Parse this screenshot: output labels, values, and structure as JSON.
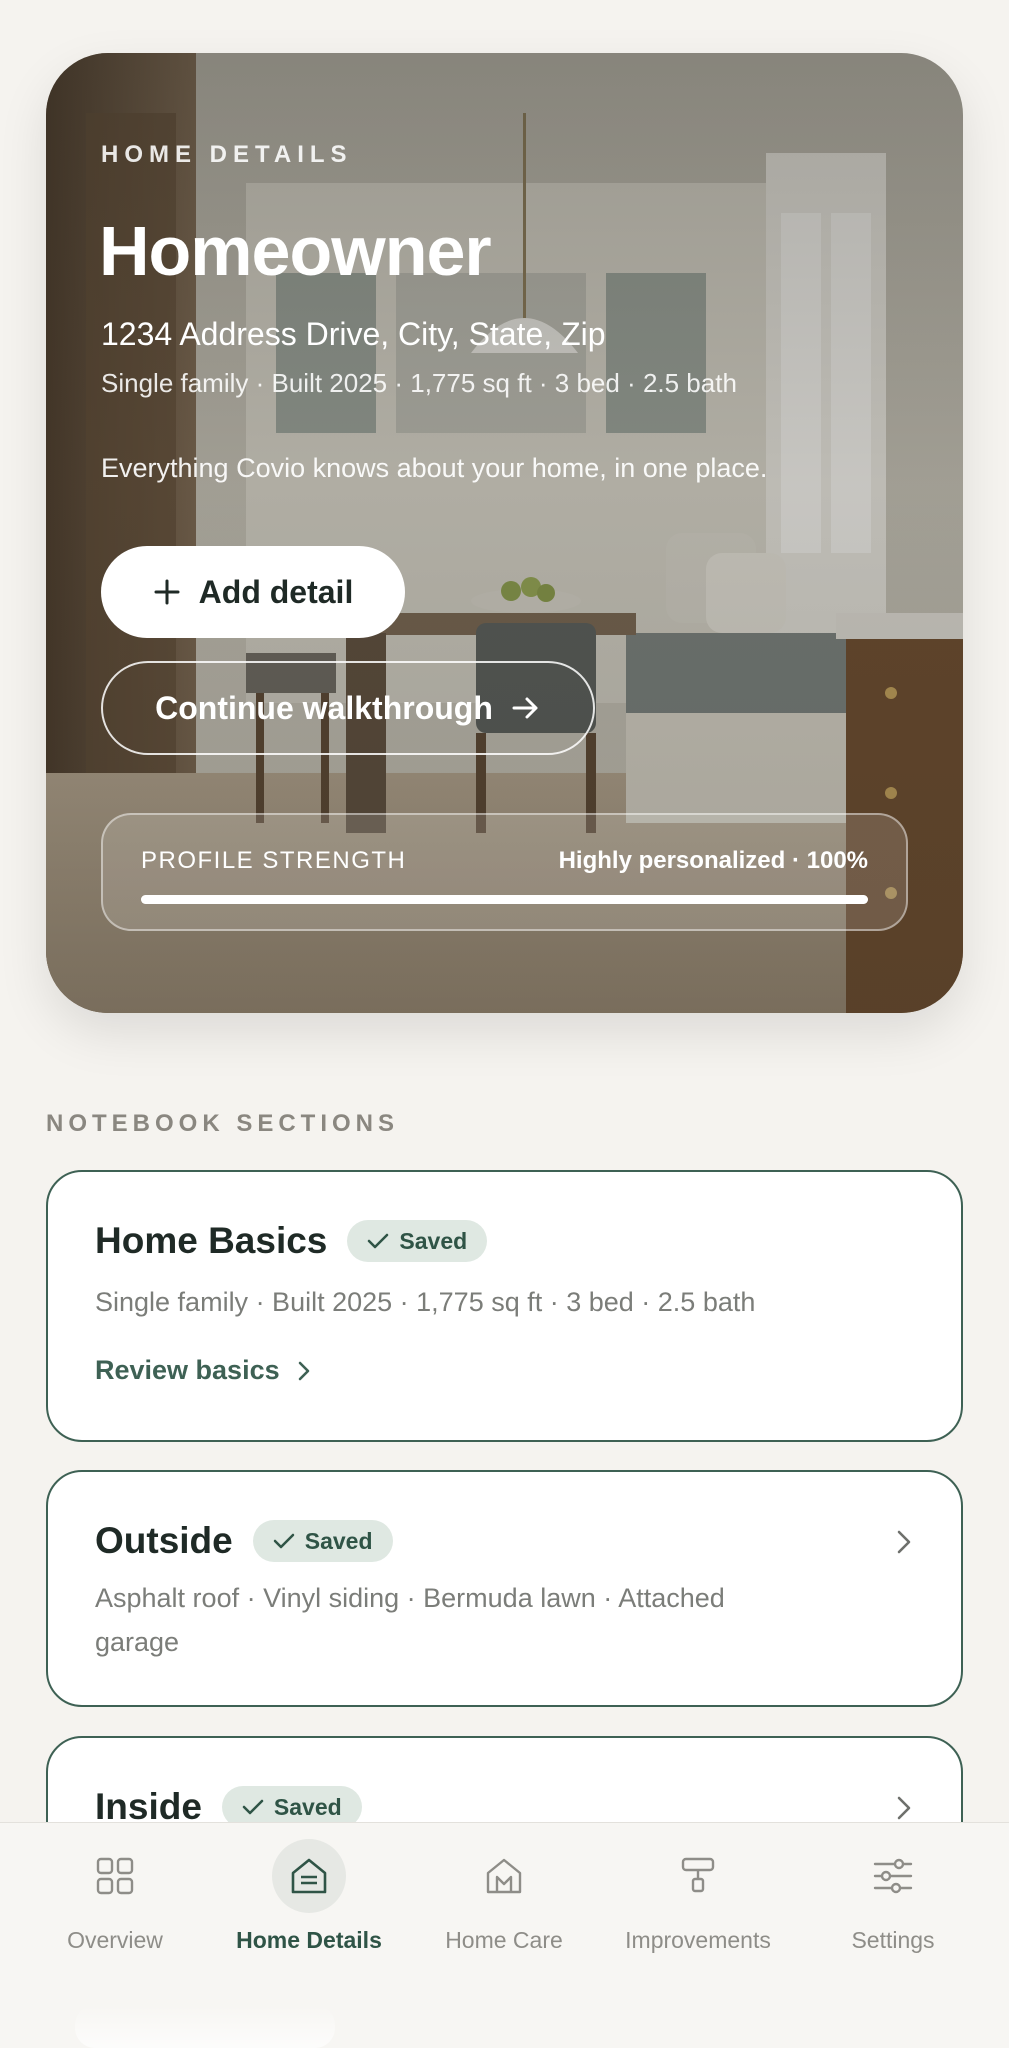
{
  "hero": {
    "eyebrow": "HOME DETAILS",
    "title": "Homeowner",
    "address": "1234 Address Drive, City, State, Zip",
    "meta": "Single family · Built 2025 · 1,775 sq ft · 3 bed · 2.5 bath",
    "tagline": "Everything Covio knows about your home, in one place.",
    "add_button": "Add detail",
    "walkthrough_button": "Continue walkthrough",
    "profile_strength": {
      "label": "PROFILE STRENGTH",
      "value_text": "Highly personalized · 100%",
      "percent": 100
    }
  },
  "notebook": {
    "title": "NOTEBOOK SECTIONS",
    "sections": [
      {
        "title": "Home Basics",
        "badge": "Saved",
        "description": "Single family · Built 2025 · 1,775 sq ft · 3 bed · 2.5 bath",
        "link": "Review basics"
      },
      {
        "title": "Outside",
        "badge": "Saved",
        "description": "Asphalt roof · Vinyl siding · Bermuda lawn · Attached garage"
      },
      {
        "title": "Inside",
        "badge": "Saved"
      }
    ]
  },
  "tabbar": {
    "tabs": [
      {
        "label": "Overview",
        "icon": "grid-icon"
      },
      {
        "label": "Home Details",
        "icon": "house-icon",
        "active": true
      },
      {
        "label": "Home Care",
        "icon": "house-tools-icon"
      },
      {
        "label": "Improvements",
        "icon": "paint-roller-icon"
      },
      {
        "label": "Settings",
        "icon": "sliders-icon"
      }
    ]
  },
  "colors": {
    "accent": "#3e6154",
    "badge_bg": "#dfe8e2",
    "background": "#f5f3ef"
  }
}
